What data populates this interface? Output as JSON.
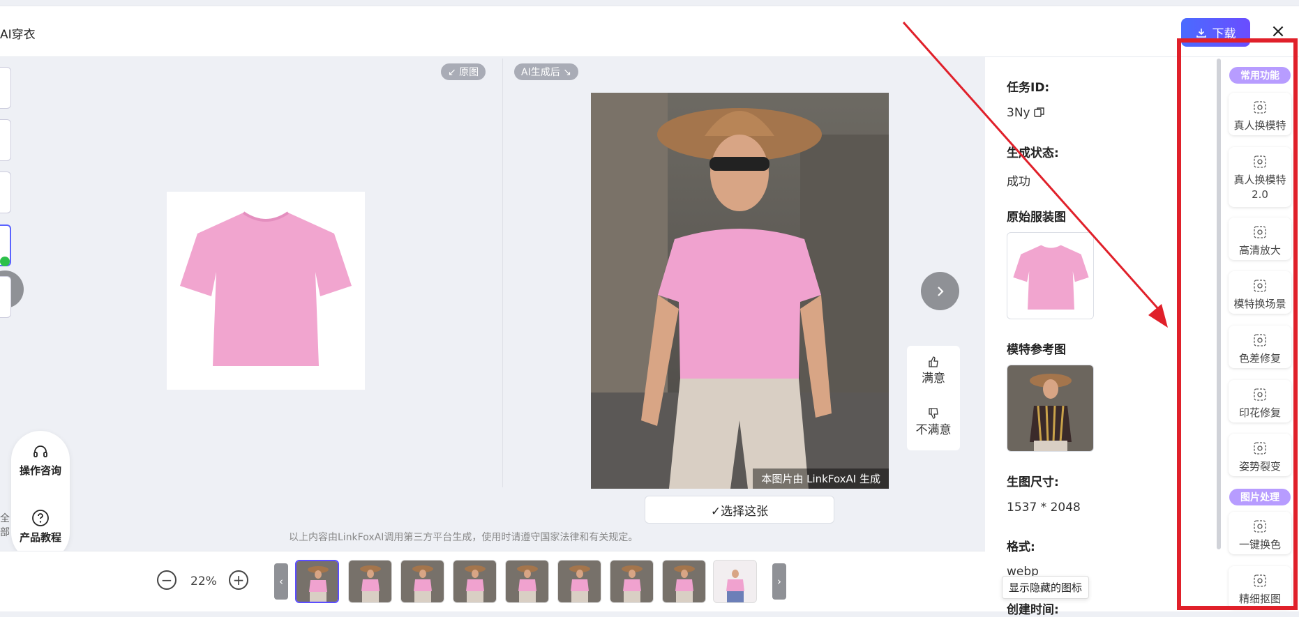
{
  "header": {
    "title": "AI穿衣",
    "download_label": "下载",
    "close_glyph": "×"
  },
  "compare": {
    "original_tag": "↙ 原图",
    "generated_tag": "AI生成后 ↘",
    "watermark": "本图片由 LinkFoxAI 生成",
    "select_label": "✓选择这张",
    "feedback_good": "满意",
    "feedback_bad": "不满意",
    "disclaimer": "以上内容由LinkFoxAI调用第三方平台生成，使用时请遵守国家法律和有关规定。"
  },
  "help": {
    "consult": "操作咨询",
    "tutorial": "产品教程",
    "cut_text": "全部"
  },
  "zoom": {
    "minus": "−",
    "plus": "+",
    "value": "22%"
  },
  "strip": {
    "prev": "‹",
    "next": "›",
    "count": 9,
    "selected_index": 0
  },
  "info": {
    "task_id_label": "任务ID:",
    "task_id_value": "3Ny",
    "status_label": "生成状态:",
    "status_value": "成功",
    "orig_clothing_label": "原始服装图",
    "model_ref_label": "模特参考图",
    "size_label": "生图尺寸:",
    "size_value": "1537 * 2048",
    "format_label": "格式:",
    "format_value": "webp",
    "created_label": "创建时间:",
    "tooltip": "显示隐藏的图标"
  },
  "tools": {
    "section_common": "常用功能",
    "section_image": "图片处理",
    "items": [
      {
        "label": "真人换模特",
        "sub": "",
        "icon": "model-swap-icon"
      },
      {
        "label": "真人换模特",
        "sub": "2.0",
        "icon": "model-swap-2-icon"
      },
      {
        "label": "高清放大",
        "sub": "",
        "icon": "upscale-icon"
      },
      {
        "label": "模特换场景",
        "sub": "",
        "icon": "scene-swap-icon"
      },
      {
        "label": "色差修复",
        "sub": "",
        "icon": "color-fix-icon"
      },
      {
        "label": "印花修复",
        "sub": "",
        "icon": "print-fix-icon"
      },
      {
        "label": "姿势裂变",
        "sub": "",
        "icon": "pose-icon"
      },
      {
        "label": "一键换色",
        "sub": "",
        "icon": "recolor-icon"
      },
      {
        "label": "精细抠图",
        "sub": "",
        "icon": "cutout-icon"
      }
    ]
  },
  "colors": {
    "accent": "#5b4dff",
    "tag_purple": "#b79cff",
    "annotation_red": "#e0202a",
    "tshirt_pink": "#f1a5cf"
  }
}
